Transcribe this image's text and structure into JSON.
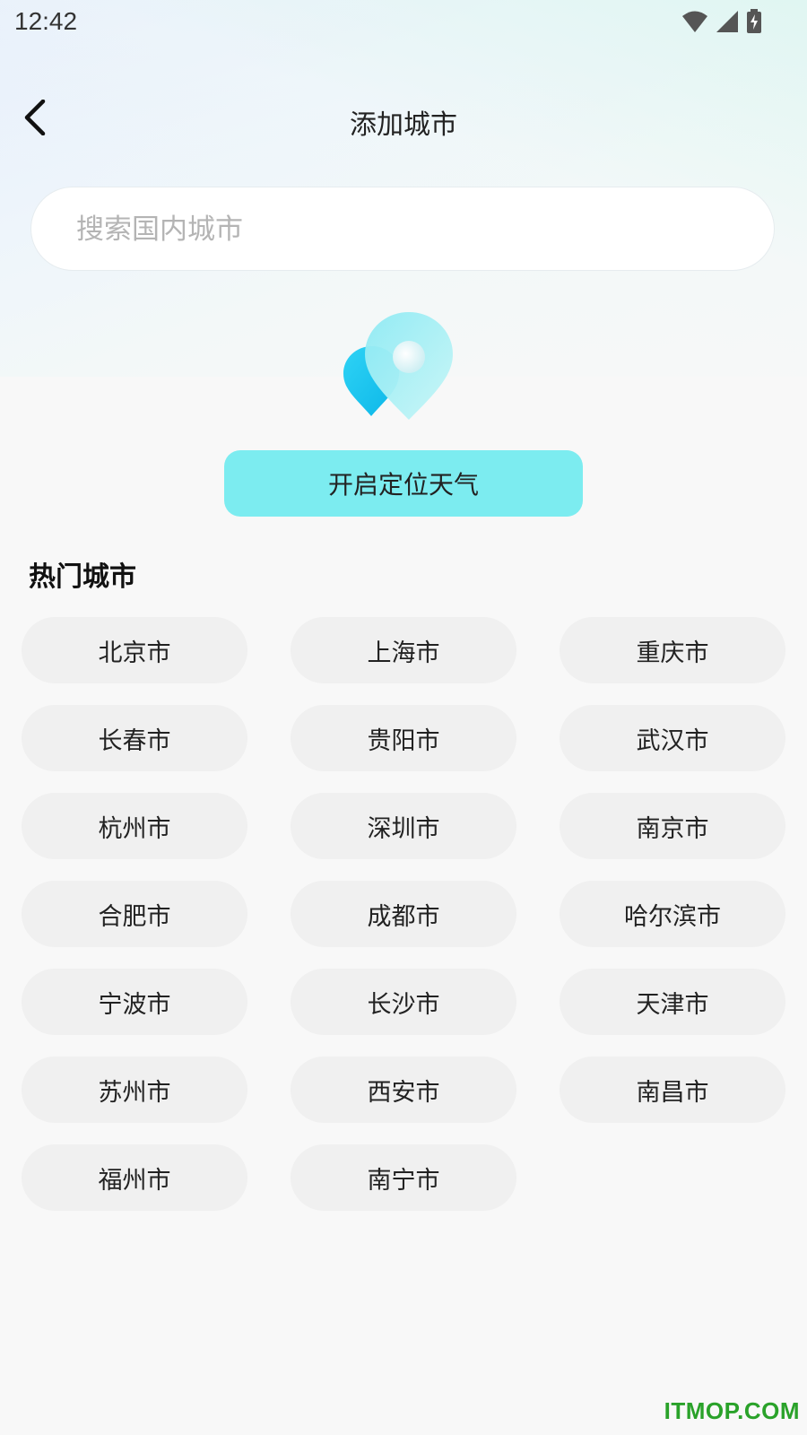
{
  "status_bar": {
    "time": "12:42",
    "icons": [
      "wifi-icon",
      "signal-icon",
      "battery-charging-icon"
    ]
  },
  "header": {
    "back_icon": "chevron-left-icon",
    "title": "添加城市"
  },
  "search": {
    "placeholder": "搜索国内城市",
    "value": ""
  },
  "location": {
    "icon": "location-pin-icon",
    "button_label": "开启定位天气"
  },
  "hot_cities": {
    "title": "热门城市",
    "items": [
      {
        "label": "北京市"
      },
      {
        "label": "上海市"
      },
      {
        "label": "重庆市"
      },
      {
        "label": "长春市"
      },
      {
        "label": "贵阳市"
      },
      {
        "label": "武汉市"
      },
      {
        "label": "杭州市"
      },
      {
        "label": "深圳市"
      },
      {
        "label": "南京市"
      },
      {
        "label": "合肥市"
      },
      {
        "label": "成都市"
      },
      {
        "label": "哈尔滨市"
      },
      {
        "label": "宁波市"
      },
      {
        "label": "长沙市"
      },
      {
        "label": "天津市"
      },
      {
        "label": "苏州市"
      },
      {
        "label": "西安市"
      },
      {
        "label": "南昌市"
      },
      {
        "label": "福州市"
      },
      {
        "label": "南宁市"
      }
    ]
  },
  "watermark": "ITMOP.COM",
  "colors": {
    "accent_button": "#7cecf0",
    "chip_bg": "#f0f0f0",
    "watermark": "#2aa22a"
  }
}
